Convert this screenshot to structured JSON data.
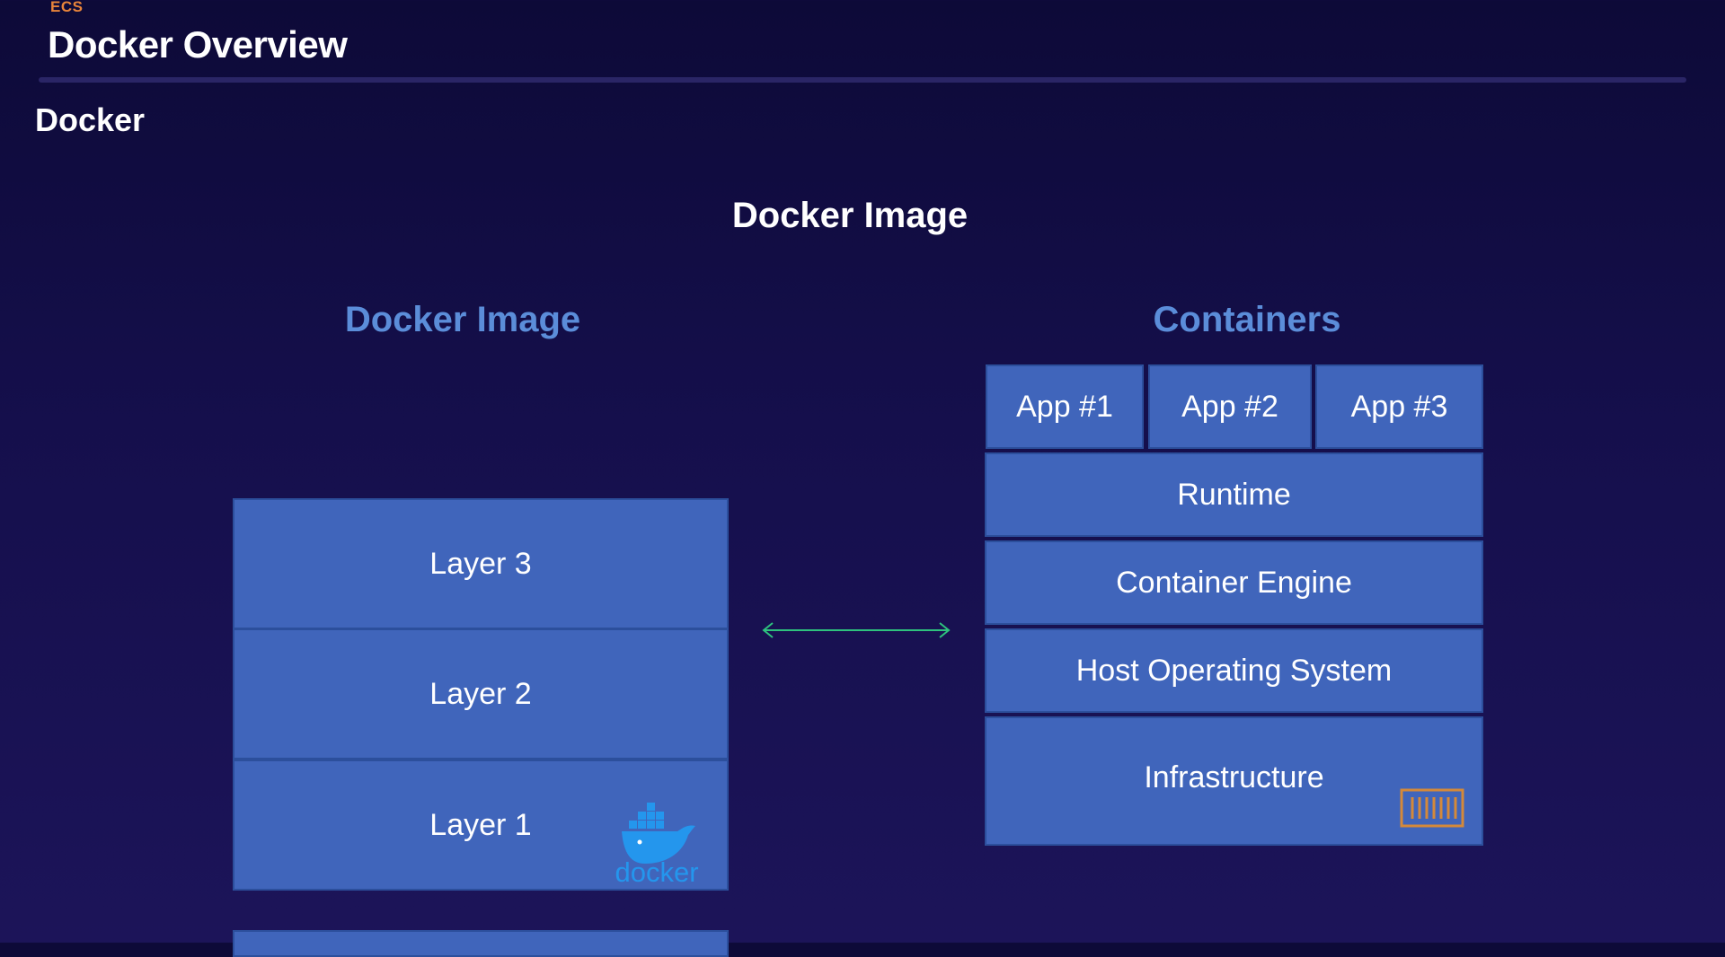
{
  "header": {
    "tag": "ECS",
    "title": "Docker Overview",
    "section": "Docker"
  },
  "diagram": {
    "title": "Docker Image",
    "image_column": {
      "title": "Docker Image",
      "layers": [
        "Layer 3",
        "Layer 2",
        "Layer 1"
      ],
      "logo_text": "docker"
    },
    "containers_column": {
      "title": "Containers",
      "apps": [
        "App #1",
        "App #2",
        "App #3"
      ],
      "stack": [
        "Runtime",
        "Container Engine",
        "Host Operating System",
        "Infrastructure"
      ]
    }
  },
  "colors": {
    "tag": "#e8843a",
    "column_title": "#5b8dd9",
    "box_fill": "#4065bb",
    "arrow": "#2ec27e",
    "container_icon": "#d4893a",
    "docker_blue": "#2496ed"
  }
}
